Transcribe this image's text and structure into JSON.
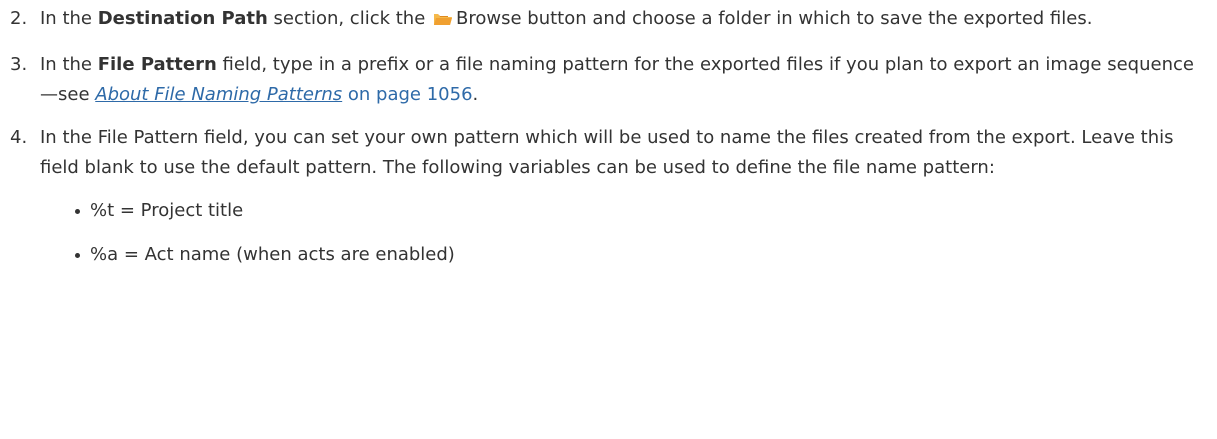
{
  "steps": [
    {
      "number": "2.",
      "pre": "In the ",
      "bold": "Destination Path",
      "mid": " section, click the ",
      "icon": "folder-icon",
      "button_label": "Browse",
      "post": " button and choose a folder in which to save the exported files."
    },
    {
      "number": "3.",
      "pre": "In the ",
      "bold": "File Pattern",
      "mid": " field, type in a prefix or a file naming pattern for the exported files if you plan to export an image sequence—see ",
      "link": "About File Naming Patterns",
      "page_ref": " on page 1056",
      "post": "."
    },
    {
      "number": "4.",
      "text": "In the File Pattern field, you can set your own pattern which will be used to name the files created from the export. Leave this field blank to use the default pattern. The following variables can be used to define the file name pattern:"
    }
  ],
  "bullets": [
    "%t = Project title",
    "%a = Act name (when acts are enabled)"
  ],
  "colors": {
    "text": "#333333",
    "link": "#2e6aa8",
    "folder_icon": "#f0a030"
  }
}
